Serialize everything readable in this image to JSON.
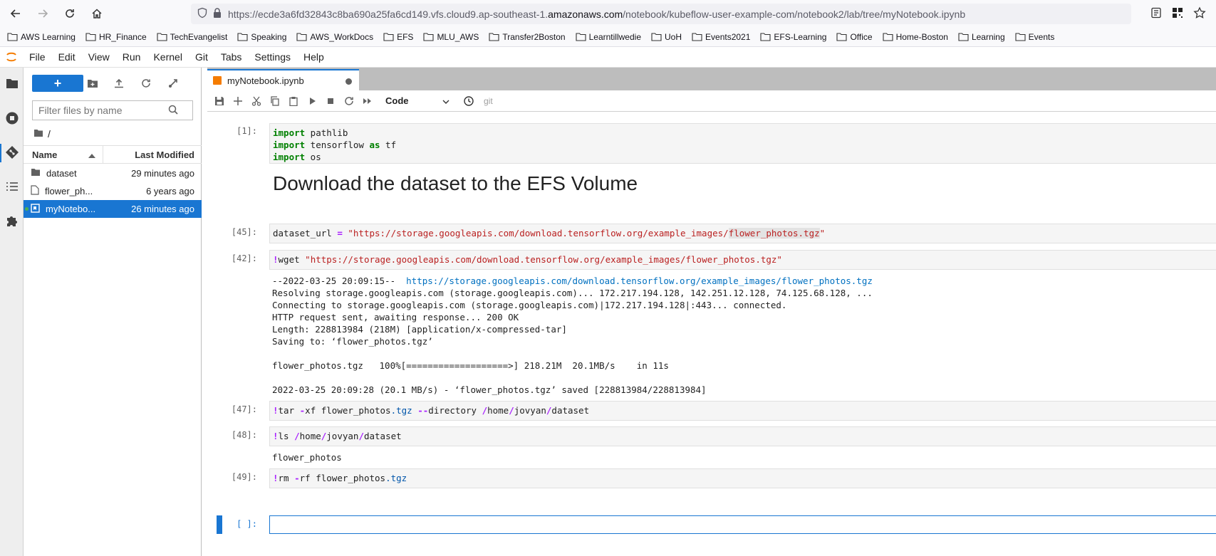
{
  "browser": {
    "url_prefix": "https://ecde3a6fd32843c8ba690a25fa6cd149.vfs.cloud9.ap-southeast-1.",
    "url_domain": "amazonaws.com",
    "url_suffix": "/notebook/kubeflow-user-example-com/notebook2/lab/tree/myNotebook.ipynb"
  },
  "bookmarks": [
    "AWS Learning",
    "HR_Finance",
    "TechEvangelist",
    "Speaking",
    "AWS_WorkDocs",
    "EFS",
    "MLU_AWS",
    "Transfer2Boston",
    "Learntillwedie",
    "UoH",
    "Events2021",
    "EFS-Learning",
    "Office",
    "Home-Boston",
    "Learning",
    "Events"
  ],
  "menubar": [
    "File",
    "Edit",
    "View",
    "Run",
    "Kernel",
    "Git",
    "Tabs",
    "Settings",
    "Help"
  ],
  "filebrowser": {
    "new_label": "+",
    "filter_placeholder": "Filter files by name",
    "breadcrumb": "/",
    "col_name": "Name",
    "col_modified": "Last Modified",
    "rows": [
      {
        "name": "dataset",
        "modified": "29 minutes ago",
        "kind": "folder"
      },
      {
        "name": "flower_ph...",
        "modified": "6 years ago",
        "kind": "file"
      },
      {
        "name": "myNotebo...",
        "modified": "26 minutes ago",
        "kind": "notebook"
      }
    ]
  },
  "notebook": {
    "tab_title": "myNotebook.ipynb",
    "cell_type": "Code",
    "git_label": "git",
    "heading": "Download the dataset to the EFS Volume",
    "prompts": {
      "c1": "[1]:",
      "c45": "[45]:",
      "c42": "[42]:",
      "c47": "[47]:",
      "c48": "[48]:",
      "c49": "[49]:",
      "empty": "[ ]:"
    },
    "cell1": {
      "kw_import": "import",
      "l1_rest": " pathlib",
      "l2_rest": " tensorflow ",
      "kw_as": "as",
      "l2_end": " tf",
      "l3_rest": " os"
    },
    "cell45": {
      "var": "dataset_url ",
      "eq": "=",
      "str_a": " \"https://storage.googleapis.com/download.tensorflow.org/example_images/",
      "str_hl": "flower_photos.tgz",
      "str_b": "\""
    },
    "cell42": {
      "bang": "!",
      "cmd": "wget ",
      "str": "\"https://storage.googleapis.com/download.tensorflow.org/example_images/flower_photos.tgz\"",
      "out_l1a": "--2022-03-25 20:09:15--  ",
      "out_l1_link": "https://storage.googleapis.com/download.tensorflow.org/example_images/flower_photos.tgz",
      "out_l2": "Resolving storage.googleapis.com (storage.googleapis.com)... 172.217.194.128, 142.251.12.128, 74.125.68.128, ...",
      "out_l3": "Connecting to storage.googleapis.com (storage.googleapis.com)|172.217.194.128|:443... connected.",
      "out_l4": "HTTP request sent, awaiting response... 200 OK",
      "out_l5": "Length: 228813984 (218M) [application/x-compressed-tar]",
      "out_l6": "Saving to: ‘flower_photos.tgz’",
      "out_l7": "flower_photos.tgz   100%[===================>] 218.21M  20.1MB/s    in 11s",
      "out_l8": "2022-03-25 20:09:28 (20.1 MB/s) - ‘flower_photos.tgz’ saved [228813984/228813984]"
    },
    "cell47": {
      "bang": "!",
      "a": "tar ",
      "op1": "-",
      "b": "xf flower_photos",
      "c": ".tgz",
      "d": " ",
      "op2": "--",
      "e": "directory ",
      "s1": "/",
      "f": "home",
      "s2": "/",
      "g": "jovyan",
      "s3": "/",
      "h": "dataset"
    },
    "cell48": {
      "bang": "!",
      "a": "ls ",
      "s1": "/",
      "b": "home",
      "s2": "/",
      "c": "jovyan",
      "s3": "/",
      "d": "dataset",
      "output": "flower_photos"
    },
    "cell49": {
      "bang": "!",
      "a": "rm ",
      "op": "-",
      "b": "rf flower_photos",
      "c": ".tgz"
    }
  }
}
